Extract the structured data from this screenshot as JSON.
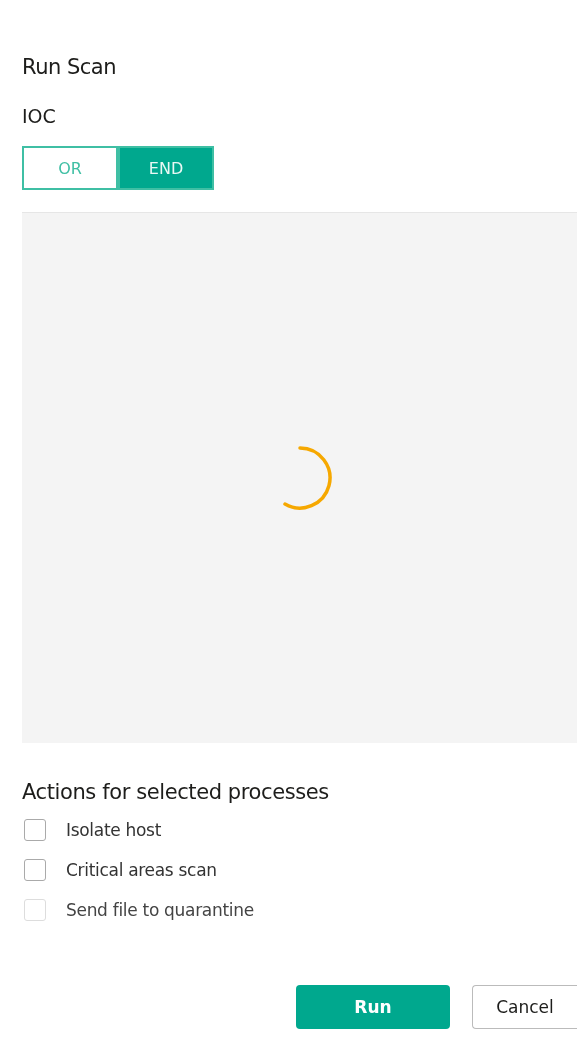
{
  "title": "Run Scan",
  "ioc": {
    "label": "IOC",
    "options": [
      {
        "label": "OR",
        "selected": false
      },
      {
        "label": "END",
        "selected": true
      }
    ]
  },
  "panel": {
    "loading": true
  },
  "actions": {
    "heading": "Actions for selected processes",
    "items": [
      {
        "label": "Isolate host",
        "checked": false,
        "disabled": false
      },
      {
        "label": "Critical areas scan",
        "checked": false,
        "disabled": false
      },
      {
        "label": "Send file to quarantine",
        "checked": false,
        "disabled": true
      }
    ]
  },
  "buttons": [
    {
      "label": "Run",
      "kind": "primary"
    },
    {
      "label": "Cancel",
      "kind": "secondary"
    }
  ]
}
